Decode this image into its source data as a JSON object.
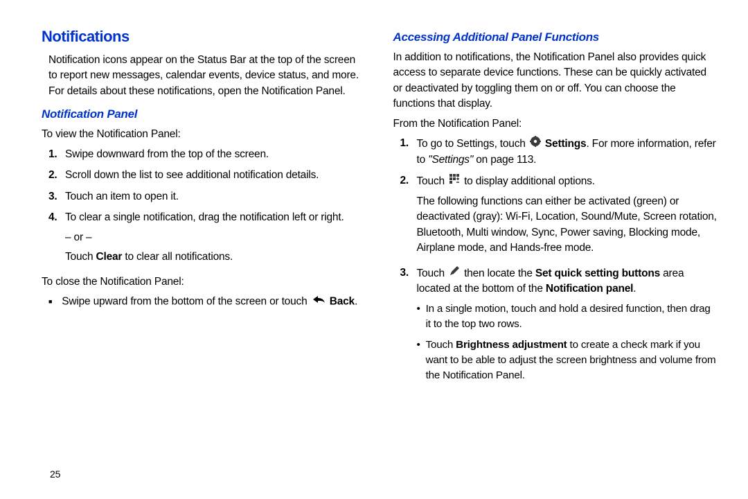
{
  "left": {
    "h1": "Notifications",
    "intro": "Notification icons appear on the Status Bar at the top of the screen to report new messages, calendar events, device status, and more. For details about these notifications, open the Notification Panel.",
    "h2": "Notification Panel",
    "view_intro": "To view the Notification Panel:",
    "steps": {
      "s1": "Swipe downward from the top of the screen.",
      "s2": "Scroll down the list to see additional notification details.",
      "s3": "Touch an item to open it.",
      "s4a": "To clear a single notification, drag the notification left or right.",
      "s4_or": "– or –",
      "s4b_pre": "Touch ",
      "s4b_bold": "Clear",
      "s4b_post": " to clear all notifications."
    },
    "close_intro": "To close the Notification Panel:",
    "close_item_pre": "Swipe upward from the bottom of the screen or touch ",
    "close_item_bold": "Back",
    "close_item_post": "."
  },
  "right": {
    "h2": "Accessing Additional Panel Functions",
    "intro": "In addition to notifications, the Notification Panel also provides quick access to separate device functions. These can be quickly activated or deactivated by toggling them on or off. You can choose the functions that display.",
    "from": "From the Notification Panel:",
    "s1_pre": "To go to Settings, touch ",
    "s1_bold": "Settings",
    "s1_mid": ". For more information, refer to ",
    "s1_ref": "\"Settings\"",
    "s1_post": " on page 113.",
    "s2_pre": "Touch ",
    "s2_post": " to display additional options.",
    "s2_body": "The following functions can either be activated (green) or deactivated (gray): Wi-Fi, Location, Sound/Mute, Screen rotation, Bluetooth, Multi window, Sync, Power saving, Blocking mode, Airplane mode, and Hands-free mode.",
    "s3_pre": "Touch ",
    "s3_mid": " then locate the ",
    "s3_bold1": "Set quick setting buttons",
    "s3_mid2": " area located at the bottom of the ",
    "s3_bold2": "Notification panel",
    "s3_post": ".",
    "b1": "In a single motion, touch and hold a desired function, then drag it to the top two rows.",
    "b2_pre": "Touch ",
    "b2_bold": "Brightness adjustment",
    "b2_post": " to create a check mark if you want to be able to adjust the screen brightness and volume from the Notification Panel."
  },
  "page": "25"
}
